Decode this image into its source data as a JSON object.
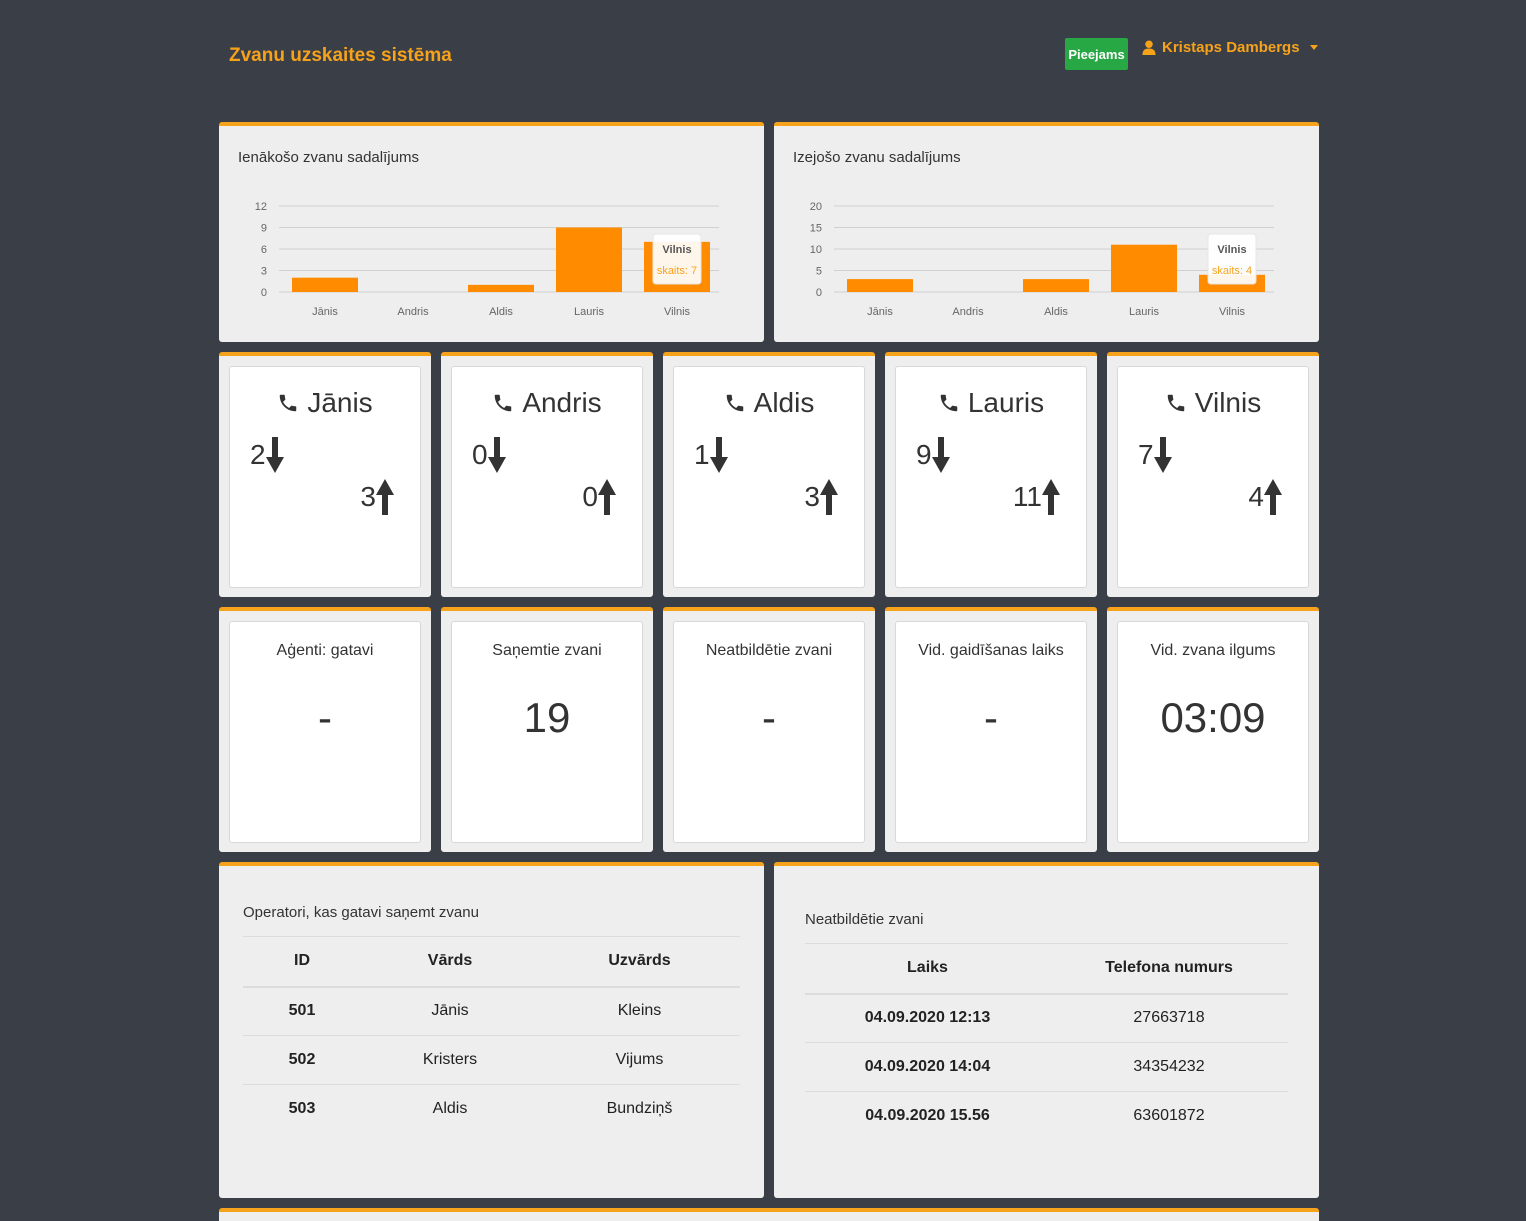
{
  "header": {
    "brand": "Zvanu uzskaites sistēma",
    "status": "Pieejams",
    "user": "Kristaps Dambergs",
    "accent": "#f7a21b",
    "status_color": "#28a745"
  },
  "charts": {
    "incoming": {
      "title": "Ienākošo zvanu sadalījums",
      "tooltip": {
        "name": "Vilnis",
        "label": "skaits: 7"
      }
    },
    "outgoing": {
      "title": "Izejošo zvanu sadalījums",
      "tooltip": {
        "name": "Vilnis",
        "label": "skaits: 4"
      }
    }
  },
  "chart_data": [
    {
      "type": "bar",
      "title": "Ienākošo zvanu sadalījums",
      "categories": [
        "Jānis",
        "Andris",
        "Aldis",
        "Lauris",
        "Vilnis"
      ],
      "values": [
        2,
        0,
        1,
        9,
        7
      ],
      "yticks": [
        0,
        3,
        6,
        9,
        12
      ],
      "ylim": [
        0,
        12
      ],
      "grid": true,
      "color": "#ff8c00"
    },
    {
      "type": "bar",
      "title": "Izejošo zvanu sadalījums",
      "categories": [
        "Jānis",
        "Andris",
        "Aldis",
        "Lauris",
        "Vilnis"
      ],
      "values": [
        3,
        0,
        3,
        11,
        4
      ],
      "yticks": [
        0,
        5,
        10,
        15,
        20
      ],
      "ylim": [
        0,
        20
      ],
      "grid": true,
      "color": "#ff8c00"
    }
  ],
  "operators": [
    {
      "name": "Jānis",
      "in": "2",
      "out": "3"
    },
    {
      "name": "Andris",
      "in": "0",
      "out": "0"
    },
    {
      "name": "Aldis",
      "in": "1",
      "out": "3"
    },
    {
      "name": "Lauris",
      "in": "9",
      "out": "11"
    },
    {
      "name": "Vilnis",
      "in": "7",
      "out": "4"
    }
  ],
  "stats": [
    {
      "label": "Aģenti: gatavi",
      "value": "-"
    },
    {
      "label": "Saņemtie zvani",
      "value": "19"
    },
    {
      "label": "Neatbildētie zvani",
      "value": "-"
    },
    {
      "label": "Vid. gaidīšanas laiks",
      "value": "-"
    },
    {
      "label": "Vid. zvana ilgums",
      "value": "03:09"
    }
  ],
  "ready_operators": {
    "title": "Operatori, kas gatavi saņemt zvanu",
    "columns": [
      "ID",
      "Vārds",
      "Uzvārds"
    ],
    "rows": [
      [
        "501",
        "Jānis",
        "Kleins"
      ],
      [
        "502",
        "Kristers",
        "Vijums"
      ],
      [
        "503",
        "Aldis",
        "Bundziņš"
      ]
    ]
  },
  "missed_calls": {
    "title": "Neatbildētie zvani",
    "columns": [
      "Laiks",
      "Telefona numurs"
    ],
    "rows": [
      [
        "04.09.2020 12:13",
        "27663718"
      ],
      [
        "04.09.2020 14:04",
        "34354232"
      ],
      [
        "04.09.2020 15.56",
        "63601872"
      ]
    ]
  }
}
